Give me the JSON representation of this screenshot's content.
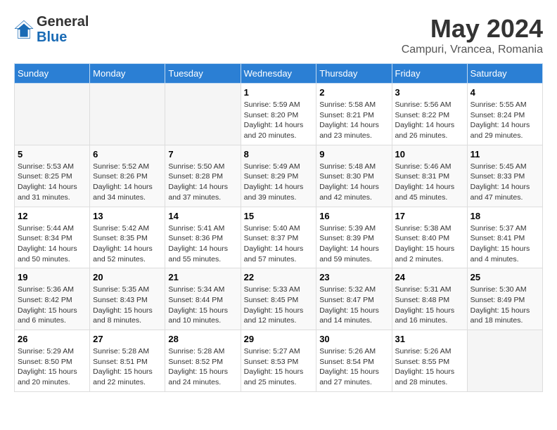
{
  "header": {
    "logo_general": "General",
    "logo_blue": "Blue",
    "month": "May 2024",
    "location": "Campuri, Vrancea, Romania"
  },
  "days_of_week": [
    "Sunday",
    "Monday",
    "Tuesday",
    "Wednesday",
    "Thursday",
    "Friday",
    "Saturday"
  ],
  "weeks": [
    [
      {
        "day": "",
        "info": ""
      },
      {
        "day": "",
        "info": ""
      },
      {
        "day": "",
        "info": ""
      },
      {
        "day": "1",
        "info": "Sunrise: 5:59 AM\nSunset: 8:20 PM\nDaylight: 14 hours\nand 20 minutes."
      },
      {
        "day": "2",
        "info": "Sunrise: 5:58 AM\nSunset: 8:21 PM\nDaylight: 14 hours\nand 23 minutes."
      },
      {
        "day": "3",
        "info": "Sunrise: 5:56 AM\nSunset: 8:22 PM\nDaylight: 14 hours\nand 26 minutes."
      },
      {
        "day": "4",
        "info": "Sunrise: 5:55 AM\nSunset: 8:24 PM\nDaylight: 14 hours\nand 29 minutes."
      }
    ],
    [
      {
        "day": "5",
        "info": "Sunrise: 5:53 AM\nSunset: 8:25 PM\nDaylight: 14 hours\nand 31 minutes."
      },
      {
        "day": "6",
        "info": "Sunrise: 5:52 AM\nSunset: 8:26 PM\nDaylight: 14 hours\nand 34 minutes."
      },
      {
        "day": "7",
        "info": "Sunrise: 5:50 AM\nSunset: 8:28 PM\nDaylight: 14 hours\nand 37 minutes."
      },
      {
        "day": "8",
        "info": "Sunrise: 5:49 AM\nSunset: 8:29 PM\nDaylight: 14 hours\nand 39 minutes."
      },
      {
        "day": "9",
        "info": "Sunrise: 5:48 AM\nSunset: 8:30 PM\nDaylight: 14 hours\nand 42 minutes."
      },
      {
        "day": "10",
        "info": "Sunrise: 5:46 AM\nSunset: 8:31 PM\nDaylight: 14 hours\nand 45 minutes."
      },
      {
        "day": "11",
        "info": "Sunrise: 5:45 AM\nSunset: 8:33 PM\nDaylight: 14 hours\nand 47 minutes."
      }
    ],
    [
      {
        "day": "12",
        "info": "Sunrise: 5:44 AM\nSunset: 8:34 PM\nDaylight: 14 hours\nand 50 minutes."
      },
      {
        "day": "13",
        "info": "Sunrise: 5:42 AM\nSunset: 8:35 PM\nDaylight: 14 hours\nand 52 minutes."
      },
      {
        "day": "14",
        "info": "Sunrise: 5:41 AM\nSunset: 8:36 PM\nDaylight: 14 hours\nand 55 minutes."
      },
      {
        "day": "15",
        "info": "Sunrise: 5:40 AM\nSunset: 8:37 PM\nDaylight: 14 hours\nand 57 minutes."
      },
      {
        "day": "16",
        "info": "Sunrise: 5:39 AM\nSunset: 8:39 PM\nDaylight: 14 hours\nand 59 minutes."
      },
      {
        "day": "17",
        "info": "Sunrise: 5:38 AM\nSunset: 8:40 PM\nDaylight: 15 hours\nand 2 minutes."
      },
      {
        "day": "18",
        "info": "Sunrise: 5:37 AM\nSunset: 8:41 PM\nDaylight: 15 hours\nand 4 minutes."
      }
    ],
    [
      {
        "day": "19",
        "info": "Sunrise: 5:36 AM\nSunset: 8:42 PM\nDaylight: 15 hours\nand 6 minutes."
      },
      {
        "day": "20",
        "info": "Sunrise: 5:35 AM\nSunset: 8:43 PM\nDaylight: 15 hours\nand 8 minutes."
      },
      {
        "day": "21",
        "info": "Sunrise: 5:34 AM\nSunset: 8:44 PM\nDaylight: 15 hours\nand 10 minutes."
      },
      {
        "day": "22",
        "info": "Sunrise: 5:33 AM\nSunset: 8:45 PM\nDaylight: 15 hours\nand 12 minutes."
      },
      {
        "day": "23",
        "info": "Sunrise: 5:32 AM\nSunset: 8:47 PM\nDaylight: 15 hours\nand 14 minutes."
      },
      {
        "day": "24",
        "info": "Sunrise: 5:31 AM\nSunset: 8:48 PM\nDaylight: 15 hours\nand 16 minutes."
      },
      {
        "day": "25",
        "info": "Sunrise: 5:30 AM\nSunset: 8:49 PM\nDaylight: 15 hours\nand 18 minutes."
      }
    ],
    [
      {
        "day": "26",
        "info": "Sunrise: 5:29 AM\nSunset: 8:50 PM\nDaylight: 15 hours\nand 20 minutes."
      },
      {
        "day": "27",
        "info": "Sunrise: 5:28 AM\nSunset: 8:51 PM\nDaylight: 15 hours\nand 22 minutes."
      },
      {
        "day": "28",
        "info": "Sunrise: 5:28 AM\nSunset: 8:52 PM\nDaylight: 15 hours\nand 24 minutes."
      },
      {
        "day": "29",
        "info": "Sunrise: 5:27 AM\nSunset: 8:53 PM\nDaylight: 15 hours\nand 25 minutes."
      },
      {
        "day": "30",
        "info": "Sunrise: 5:26 AM\nSunset: 8:54 PM\nDaylight: 15 hours\nand 27 minutes."
      },
      {
        "day": "31",
        "info": "Sunrise: 5:26 AM\nSunset: 8:55 PM\nDaylight: 15 hours\nand 28 minutes."
      },
      {
        "day": "",
        "info": ""
      }
    ]
  ]
}
